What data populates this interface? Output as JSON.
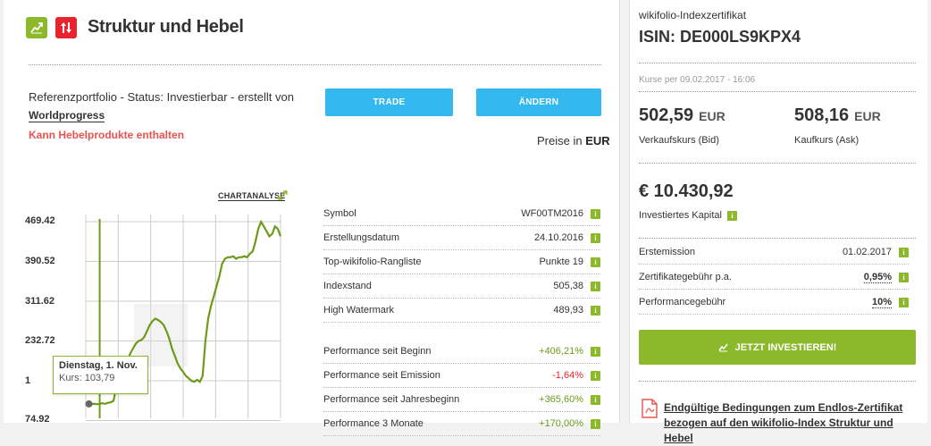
{
  "header": {
    "title": "Struktur und Hebel"
  },
  "reference": {
    "text": "Referenzportfolio - Status: Investierbar - erstellt von",
    "author": "Worldprogress",
    "warning": "Kann Hebelprodukte enthalten"
  },
  "buttons": {
    "trade": "TRADE",
    "aendern": "ÄNDERN"
  },
  "preise": {
    "label": "Preise in",
    "currency": "EUR"
  },
  "chart": {
    "link": "CHARTANALYSE",
    "tooltip_date": "Dienstag, 1. Nov.",
    "tooltip_value": "Kurs: 103,79"
  },
  "chart_data": {
    "type": "line",
    "yticks": [
      "469.42",
      "390.52",
      "311.62",
      "232.72",
      "1",
      "74.92"
    ],
    "ylim": [
      74.92,
      469.42
    ],
    "grid": true,
    "series": [
      {
        "color": "#6e9a1a",
        "x": [
          0,
          1,
          2,
          3,
          4,
          5,
          6,
          7,
          8,
          9,
          10,
          11,
          12,
          13,
          14,
          15,
          16,
          17,
          18,
          19,
          20,
          21,
          22,
          23,
          24,
          25,
          26,
          27,
          28,
          29,
          30,
          31,
          32,
          33,
          34,
          35,
          36,
          37,
          38,
          39,
          40,
          41,
          42,
          43,
          44,
          45,
          46,
          47,
          48,
          49,
          50,
          51,
          52,
          53,
          54,
          55,
          56,
          57,
          58,
          59,
          60,
          61,
          62,
          63,
          64,
          65,
          66,
          67,
          68,
          69,
          70
        ],
        "values": [
          103,
          104,
          103,
          104,
          103,
          104,
          105,
          104,
          106,
          107,
          110,
          140,
          150,
          160,
          175,
          190,
          205,
          215,
          225,
          230,
          232,
          238,
          250,
          262,
          270,
          275,
          272,
          268,
          262,
          250,
          235,
          215,
          200,
          185,
          175,
          168,
          160,
          155,
          150,
          148,
          152,
          148,
          160,
          230,
          275,
          300,
          320,
          340,
          360,
          385,
          395,
          398,
          398,
          400,
          395,
          398,
          398,
          400,
          398,
          405,
          410,
          430,
          455,
          469,
          460,
          450,
          440,
          445,
          460,
          455,
          440
        ],
        "highlight_x": 5,
        "highlight_value": 103.79
      }
    ]
  },
  "details": [
    {
      "label": "Symbol",
      "value": "WF00TM2016"
    },
    {
      "label": "Erstellungsdatum",
      "value": "24.10.2016"
    },
    {
      "label": "Top-wikifolio-Rangliste",
      "value": "Punkte 19"
    },
    {
      "label": "Indexstand",
      "value": "505,38"
    },
    {
      "label": "High Watermark",
      "value": "489,93"
    }
  ],
  "performance": [
    {
      "label": "Performance seit Beginn",
      "value": "+406,21%",
      "sign": "pos"
    },
    {
      "label": "Performance seit Emission",
      "value": "-1,64%",
      "sign": "neg"
    },
    {
      "label": "Performance seit Jahresbeginn",
      "value": "+365,60%",
      "sign": "pos"
    },
    {
      "label": "Performance 3 Monate",
      "value": "+170,00%",
      "sign": "pos"
    }
  ],
  "sidebar": {
    "subtitle": "wikifolio-Indexzertifikat",
    "isin": "ISIN: DE000LS9KPX4",
    "date": "Kurse per 09.02.2017 - 16:06",
    "bid_value": "502,59",
    "bid_unit": "EUR",
    "bid_label": "Verkaufskurs (Bid)",
    "ask_value": "508,16",
    "ask_unit": "EUR",
    "ask_label": "Kaufkurs (Ask)",
    "kapital": "€ 10.430,92",
    "kapital_label": "Investiertes Kapital",
    "rows": [
      {
        "label": "Erstemission",
        "value": "01.02.2017"
      },
      {
        "label": "Zertifikategebühr p.a.",
        "value": "0,95%"
      },
      {
        "label": "Performancegebühr",
        "value": "10%"
      }
    ],
    "invest_button": "JETZT INVESTIEREN!",
    "bedingungen": "Endgültige Bedingungen zum Endlos-Zertifikat bezogen auf den wikifolio-Index Struktur und Hebel"
  },
  "colors": {
    "accent_blue": "#33b8f0",
    "accent_green": "#8cb82b",
    "accent_red": "#e8242c"
  }
}
